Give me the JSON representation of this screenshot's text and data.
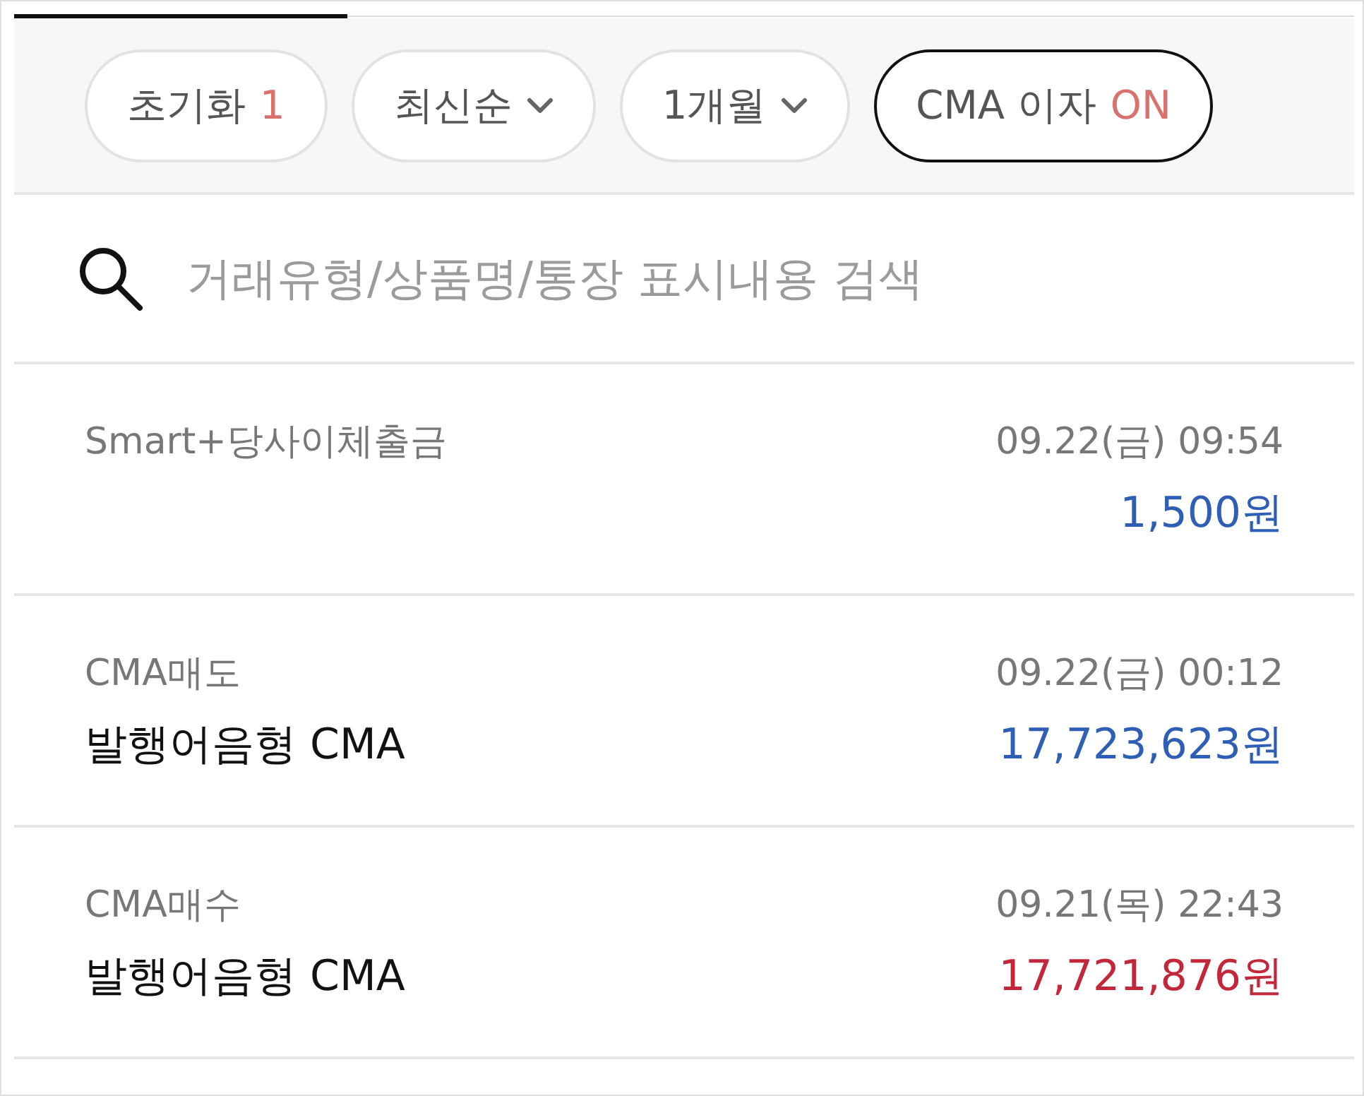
{
  "filters": [
    {
      "kind": "reset",
      "label": "초기화",
      "count": "1"
    },
    {
      "kind": "dropdown",
      "label": "최신순"
    },
    {
      "kind": "dropdown",
      "label": "1개월"
    },
    {
      "kind": "toggle",
      "label": "CMA 이자",
      "state_text": "ON",
      "on": true
    }
  ],
  "search": {
    "placeholder": "거래유형/상품명/통장 표시내용 검색"
  },
  "transactions": [
    {
      "type": "Smart+당사이체출금",
      "datetime": "09.22(금) 09:54",
      "amount": "1,500원",
      "color": "#2f5fb4"
    },
    {
      "type": "CMA매도",
      "product": "발행어음형 CMA",
      "datetime": "09.22(금) 00:12",
      "amount": "17,723,623원",
      "color": "#2f5fb4"
    },
    {
      "type": "CMA매수",
      "product": "발행어음형 CMA",
      "datetime": "09.21(목) 22:43",
      "amount": "17,721,876원",
      "color": "#c2283a"
    }
  ]
}
